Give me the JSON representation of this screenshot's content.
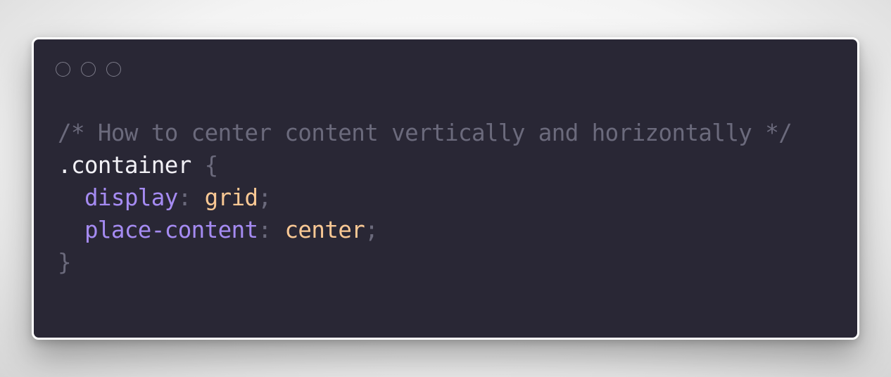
{
  "window": {
    "controls": [
      "close",
      "minimize",
      "maximize"
    ]
  },
  "code": {
    "comment": "/* How to center content vertically and horizontally */",
    "selector": ".container",
    "open_brace": "{",
    "close_brace": "}",
    "declarations": [
      {
        "property": "display",
        "colon": ":",
        "value": "grid",
        "semicolon": ";"
      },
      {
        "property": "place-content",
        "colon": ":",
        "value": "center",
        "semicolon": ";"
      }
    ]
  },
  "colors": {
    "background": "#292735",
    "comment": "#6b6a7c",
    "selector": "#f2f1f6",
    "property": "#a58bf2",
    "value": "#f9c894",
    "punctuation": "#6b6a7c"
  }
}
